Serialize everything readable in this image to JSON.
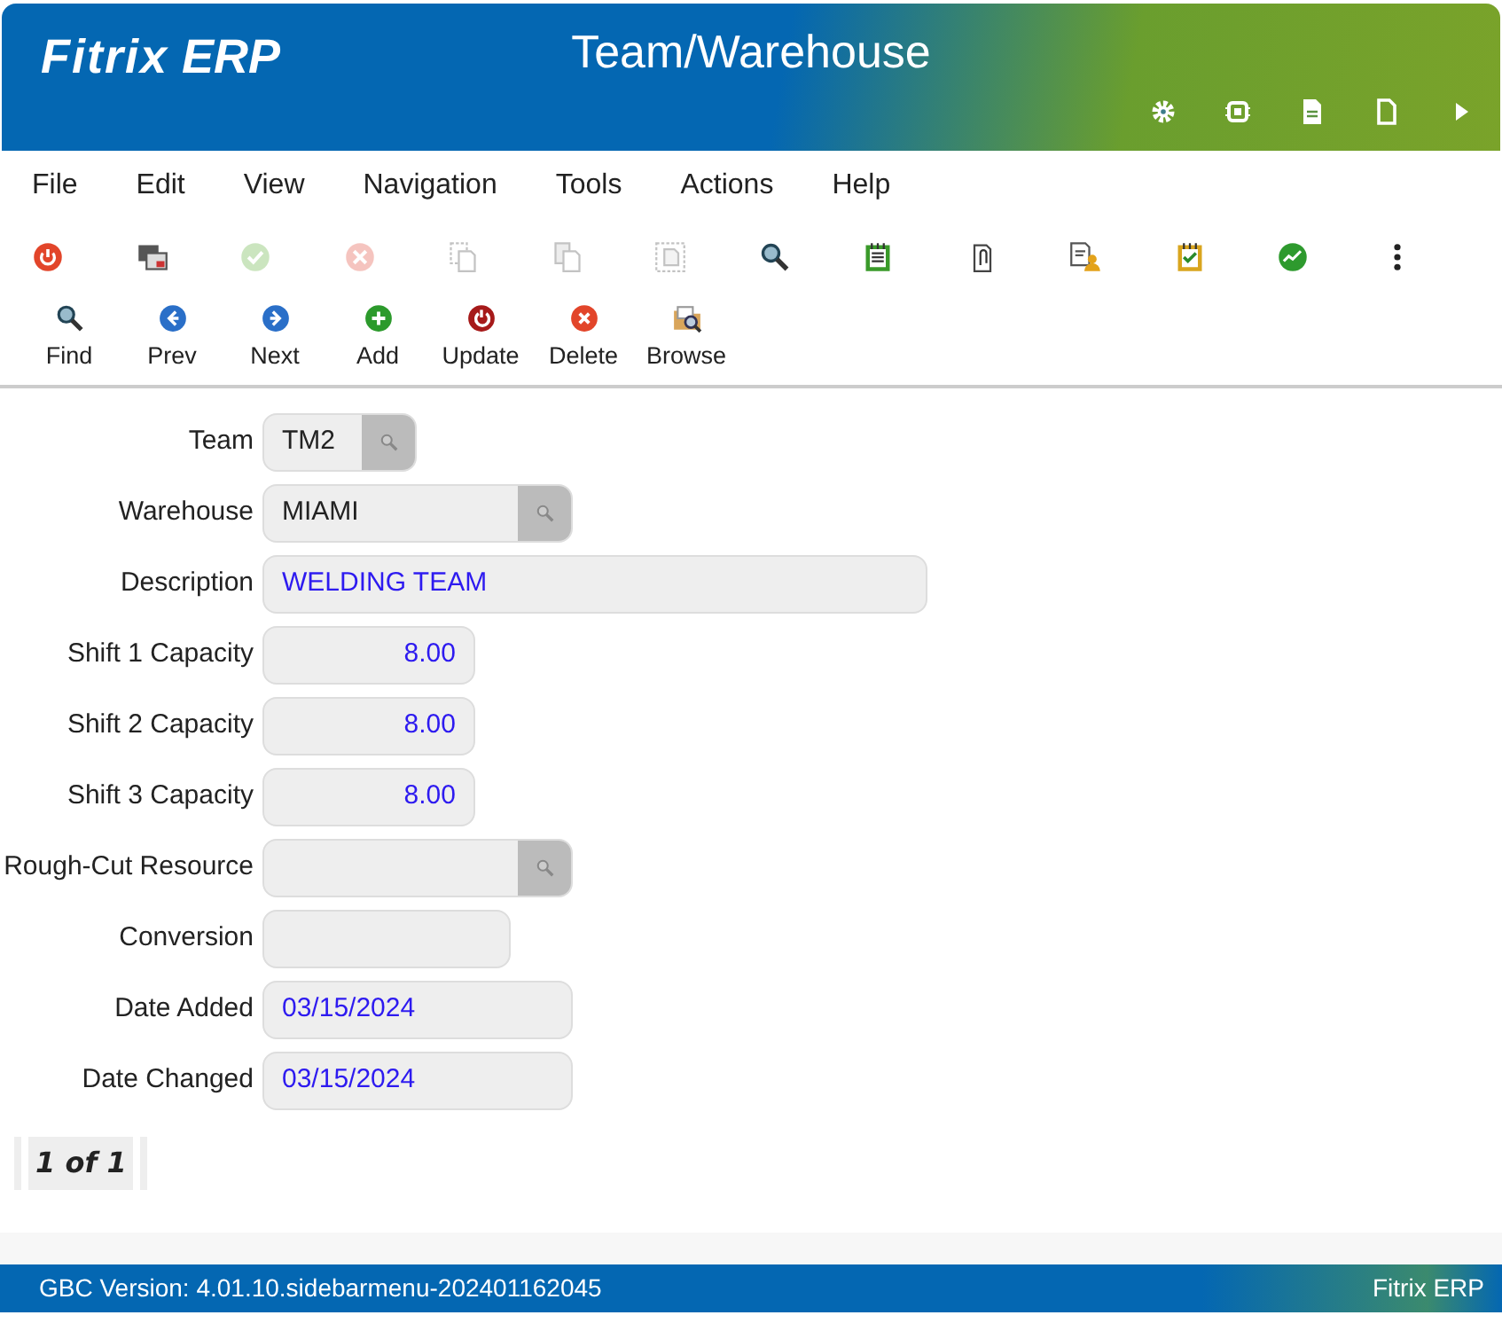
{
  "app": {
    "logo": "Fitrix",
    "logo_suffix": "ERP",
    "title": "Team/Warehouse"
  },
  "menu": [
    "File",
    "Edit",
    "View",
    "Navigation",
    "Tools",
    "Actions",
    "Help"
  ],
  "toolbar": [
    {
      "kind": "power",
      "disabled": false
    },
    {
      "kind": "windows",
      "disabled": false
    },
    {
      "kind": "check",
      "disabled": true
    },
    {
      "kind": "cancel",
      "disabled": true
    },
    {
      "kind": "copy",
      "disabled": true
    },
    {
      "kind": "paste",
      "disabled": true
    },
    {
      "kind": "select",
      "disabled": true
    },
    {
      "kind": "zoom",
      "disabled": false
    },
    {
      "kind": "notepad",
      "disabled": false
    },
    {
      "kind": "clip",
      "disabled": false
    },
    {
      "kind": "person-doc",
      "disabled": false
    },
    {
      "kind": "checklist",
      "disabled": false
    },
    {
      "kind": "chart",
      "disabled": false
    },
    {
      "kind": "more",
      "disabled": false
    }
  ],
  "actions": [
    {
      "kind": "find",
      "label": "Find"
    },
    {
      "kind": "prev",
      "label": "Prev"
    },
    {
      "kind": "next",
      "label": "Next"
    },
    {
      "kind": "add",
      "label": "Add"
    },
    {
      "kind": "update",
      "label": "Update"
    },
    {
      "kind": "delete",
      "label": "Delete"
    },
    {
      "kind": "browse",
      "label": "Browse"
    }
  ],
  "fields": [
    {
      "label": "Team",
      "value": "TM2",
      "kind": "lookup"
    },
    {
      "label": "Warehouse",
      "value": "MIAMI",
      "kind": "lookup"
    },
    {
      "label": "Description",
      "value": "WELDING TEAM",
      "kind": "text"
    },
    {
      "label": "Shift 1 Capacity",
      "value": "8.00",
      "kind": "number"
    },
    {
      "label": "Shift 2 Capacity",
      "value": "8.00",
      "kind": "number"
    },
    {
      "label": "Shift 3 Capacity",
      "value": "8.00",
      "kind": "number"
    },
    {
      "label": "Rough-Cut Resource",
      "kind": "lookup"
    },
    {
      "label": "Conversion",
      "kind": "text"
    },
    {
      "label": "Date Added",
      "value": "03/15/2024",
      "kind": "text"
    },
    {
      "label": "Date Changed",
      "value": "03/15/2024",
      "kind": "text"
    }
  ],
  "pager": "1 of 1",
  "status_bar": {
    "version": "GBC Version: 4.01.10.sidebarmenu-202401162045",
    "product": "Fitrix ERP"
  }
}
